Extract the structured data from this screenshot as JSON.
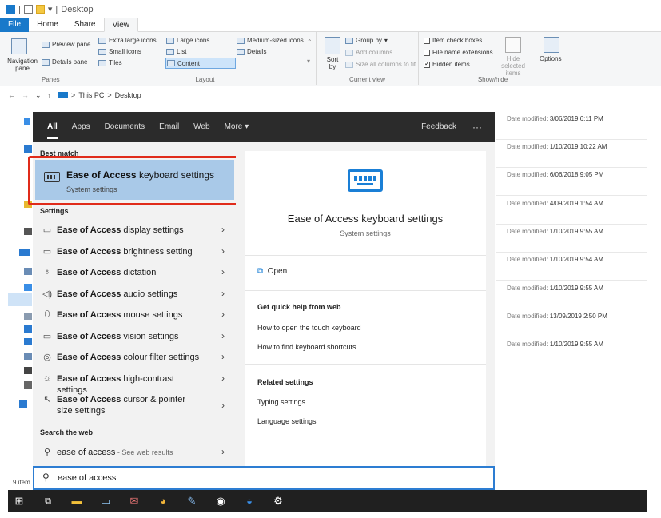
{
  "titlebar": {
    "path": "Desktop",
    "separator": "|"
  },
  "ribbon_tabs": [
    "File",
    "Home",
    "Share",
    "View"
  ],
  "ribbon": {
    "panes": {
      "label": "Panes",
      "nav_pane": "Navigation pane",
      "preview": "Preview pane",
      "details": "Details pane"
    },
    "layout": {
      "label": "Layout",
      "items": [
        "Extra large icons",
        "Large icons",
        "Medium-sized icons",
        "Small icons",
        "List",
        "Details",
        "Tiles",
        "Content"
      ]
    },
    "current_view": {
      "label": "Current view",
      "sort": "Sort by",
      "group": "Group by",
      "add_columns": "Add columns",
      "size_columns": "Size all columns to fit"
    },
    "show_hide": {
      "label": "Show/hide",
      "checkboxes": [
        {
          "label": "Item check boxes",
          "checked": false
        },
        {
          "label": "File name extensions",
          "checked": false
        },
        {
          "label": "Hidden items",
          "checked": true
        }
      ],
      "hide_selected": "Hide selected items",
      "options": "Options"
    }
  },
  "address": {
    "root": "This PC",
    "sep": ">",
    "current": "Desktop"
  },
  "file_dates": [
    {
      "label": "Date modified:",
      "value": "3/06/2019 6:11 PM"
    },
    {
      "label": "Date modified:",
      "value": "1/10/2019 10:22 AM"
    },
    {
      "label": "Date modified:",
      "value": "6/06/2018 9:05 PM"
    },
    {
      "label": "Date modified:",
      "value": "4/09/2019 1:54 AM"
    },
    {
      "label": "Date modified:",
      "value": "1/10/2019 9:55 AM"
    },
    {
      "label": "Date modified:",
      "value": "1/10/2019 9:54 AM"
    },
    {
      "label": "Date modified:",
      "value": "1/10/2019 9:55 AM"
    },
    {
      "label": "Date modified:",
      "value": "13/09/2019 2:50 PM"
    },
    {
      "label": "Date modified:",
      "value": "1/10/2019 9:55 AM"
    }
  ],
  "status": {
    "count": "9 item"
  },
  "search": {
    "filters": [
      "All",
      "Apps",
      "Documents",
      "Email",
      "Web",
      "More"
    ],
    "feedback": "Feedback",
    "more_dots": "···",
    "best_match_header": "Best match",
    "best_match": {
      "bold": "Ease of Access",
      "rest": " keyboard settings",
      "subtitle": "System settings"
    },
    "settings_header": "Settings",
    "settings": [
      {
        "bold": "Ease of Access",
        "rest": " display settings",
        "icon": "monitor-icon"
      },
      {
        "bold": "Ease of Access",
        "rest": " brightness setting",
        "icon": "monitor-icon"
      },
      {
        "bold": "Ease of Access",
        "rest": " dictation",
        "icon": "microphone-icon"
      },
      {
        "bold": "Ease of Access",
        "rest": " audio settings",
        "icon": "speaker-icon"
      },
      {
        "bold": "Ease of Access",
        "rest": " mouse settings",
        "icon": "mouse-icon"
      },
      {
        "bold": "Ease of Access",
        "rest": " vision settings",
        "icon": "monitor-icon"
      },
      {
        "bold": "Ease of Access",
        "rest": " colour filter settings",
        "icon": "palette-icon"
      },
      {
        "bold": "Ease of Access",
        "rest": " high-contrast settings",
        "icon": "brightness-icon"
      },
      {
        "bold": "Ease of Access",
        "rest": " cursor & pointer size settings",
        "icon": "pointer-icon"
      }
    ],
    "web_header": "Search the web",
    "web_result": {
      "query": "ease of access",
      "suffix": " - See web results"
    },
    "query": "ease of access",
    "detail": {
      "title": "Ease of Access keyboard settings",
      "subtitle": "System settings",
      "open": "Open",
      "help_header": "Get quick help from web",
      "help_links": [
        "How to open the touch keyboard",
        "How to find keyboard shortcuts"
      ],
      "related_header": "Related settings",
      "related_links": [
        "Typing settings",
        "Language settings"
      ]
    }
  }
}
